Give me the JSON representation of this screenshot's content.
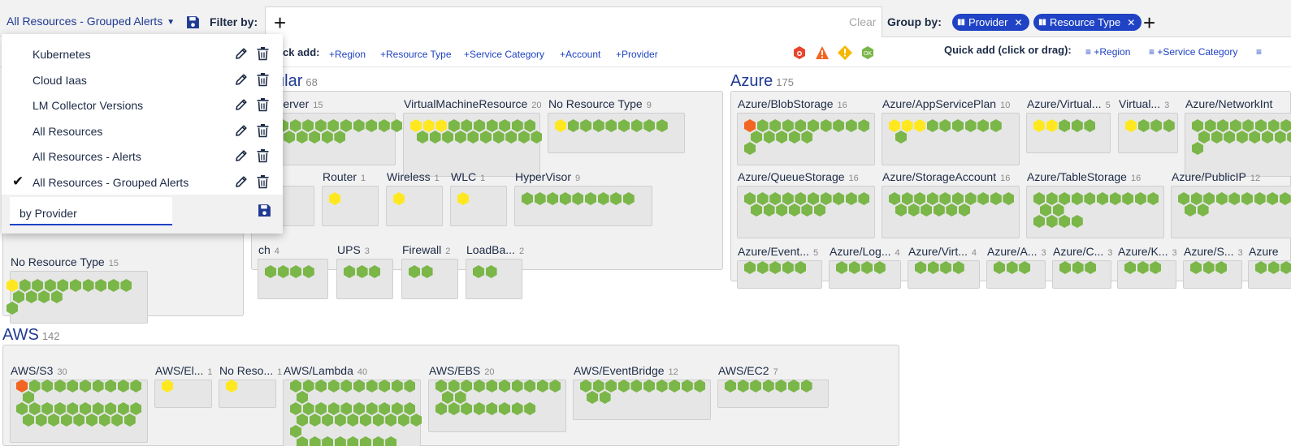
{
  "toolbar": {
    "view_title": "All Resources - Grouped Alerts",
    "filter_label": "Filter by:",
    "clear_label": "Clear",
    "group_label": "Group by:",
    "group_chips": [
      {
        "label": "Provider"
      },
      {
        "label": "Resource Type"
      }
    ]
  },
  "quick_add_left": {
    "label": "ck add:",
    "items": [
      "+Region",
      "+Resource Type",
      "+Service Category",
      "+Account",
      "+Provider"
    ]
  },
  "quick_add_right": {
    "label": "Quick add (click or drag):",
    "items": [
      "+Region",
      "+Service Category"
    ]
  },
  "colors": {
    "accent": "#1f43c4",
    "critical": "#f26522",
    "warning": "#ffe81f",
    "ok": "#7ab648"
  },
  "dropdown": {
    "items": [
      {
        "label": "Kubernetes",
        "selected": false
      },
      {
        "label": "Cloud Iaas",
        "selected": false
      },
      {
        "label": "LM Collector Versions",
        "selected": false
      },
      {
        "label": "All Resources",
        "selected": false
      },
      {
        "label": "All Resources - Alerts",
        "selected": false
      },
      {
        "label": "All Resources - Grouped Alerts",
        "selected": true
      }
    ],
    "new_view_value": "by Provider"
  },
  "groups": [
    {
      "key": "left",
      "title": "",
      "count": "",
      "tiles": [
        {
          "title": "No Resource Type",
          "count": "15"
        }
      ]
    },
    {
      "key": "regular",
      "title": "ular",
      "count": "68",
      "tiles": [
        {
          "title": "icalServer",
          "count": "15"
        },
        {
          "title": "VirtualMachineResource",
          "count": "20"
        },
        {
          "title": "No Resource Type",
          "count": "9"
        },
        {
          "title": "er",
          "count": "1"
        },
        {
          "title": "Router",
          "count": "1"
        },
        {
          "title": "Wireless",
          "count": "1"
        },
        {
          "title": "WLC",
          "count": "1"
        },
        {
          "title": "HyperVisor",
          "count": "9"
        },
        {
          "title": "ch",
          "count": "4"
        },
        {
          "title": "UPS",
          "count": "3"
        },
        {
          "title": "Firewall",
          "count": "2"
        },
        {
          "title": "LoadBa...",
          "count": "2"
        }
      ]
    },
    {
      "key": "azure",
      "title": "Azure",
      "count": "175",
      "tiles": [
        {
          "title": "Azure/BlobStorage",
          "count": "16"
        },
        {
          "title": "Azure/AppServicePlan",
          "count": "10"
        },
        {
          "title": "Azure/Virtual...",
          "count": "5"
        },
        {
          "title": "Virtual...",
          "count": "3"
        },
        {
          "title": "Azure/NetworkInt",
          "count": ""
        },
        {
          "title": "Azure/QueueStorage",
          "count": "16"
        },
        {
          "title": "Azure/StorageAccount",
          "count": "16"
        },
        {
          "title": "Azure/TableStorage",
          "count": "16"
        },
        {
          "title": "Azure/PublicIP",
          "count": "12"
        },
        {
          "title": "Azure/Event...",
          "count": "5"
        },
        {
          "title": "Azure/Log...",
          "count": "4"
        },
        {
          "title": "Azure/Virt...",
          "count": "4"
        },
        {
          "title": "Azure/A...",
          "count": "3"
        },
        {
          "title": "Azure/C...",
          "count": "3"
        },
        {
          "title": "Azure/K...",
          "count": "3"
        },
        {
          "title": "Azure/S...",
          "count": "3"
        },
        {
          "title": "Azure",
          "count": ""
        }
      ]
    },
    {
      "key": "aws",
      "title": "AWS",
      "count": "142",
      "tiles": [
        {
          "title": "AWS/S3",
          "count": "30"
        },
        {
          "title": "AWS/El...",
          "count": "1"
        },
        {
          "title": "No Reso...",
          "count": "1"
        },
        {
          "title": "AWS/Lambda",
          "count": "40"
        },
        {
          "title": "AWS/EBS",
          "count": "20"
        },
        {
          "title": "AWS/EventBridge",
          "count": "12"
        },
        {
          "title": "AWS/EC2",
          "count": "7"
        }
      ]
    }
  ]
}
